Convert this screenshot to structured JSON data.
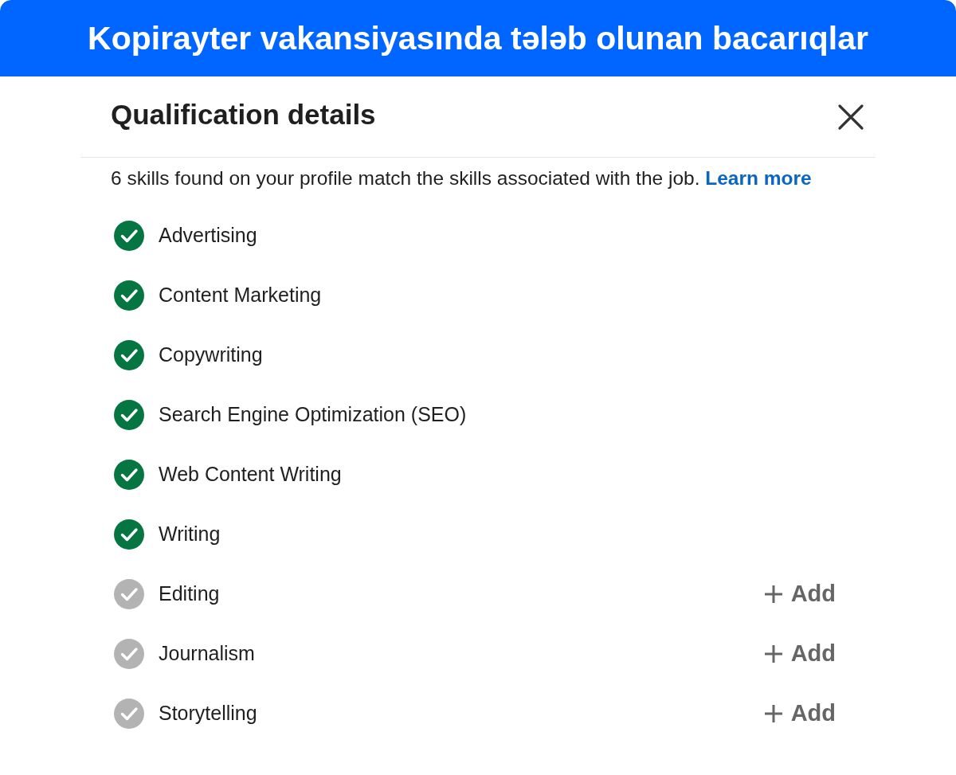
{
  "banner": {
    "title": "Kopirayter vakansiyasında tələb olunan bacarıqlar"
  },
  "dialog": {
    "title": "Qualification details",
    "description": "6 skills found on your profile match the skills associated with the job.",
    "link": "Learn more"
  },
  "skills": [
    {
      "name": "Advertising",
      "matched": true
    },
    {
      "name": "Content Marketing",
      "matched": true
    },
    {
      "name": "Copywriting",
      "matched": true
    },
    {
      "name": "Search Engine Optimization (SEO)",
      "matched": true
    },
    {
      "name": "Web Content Writing",
      "matched": true
    },
    {
      "name": "Writing",
      "matched": true
    },
    {
      "name": "Editing",
      "matched": false,
      "action": "Add"
    },
    {
      "name": "Journalism",
      "matched": false,
      "action": "Add"
    },
    {
      "name": "Storytelling",
      "matched": false,
      "action": "Add"
    }
  ]
}
